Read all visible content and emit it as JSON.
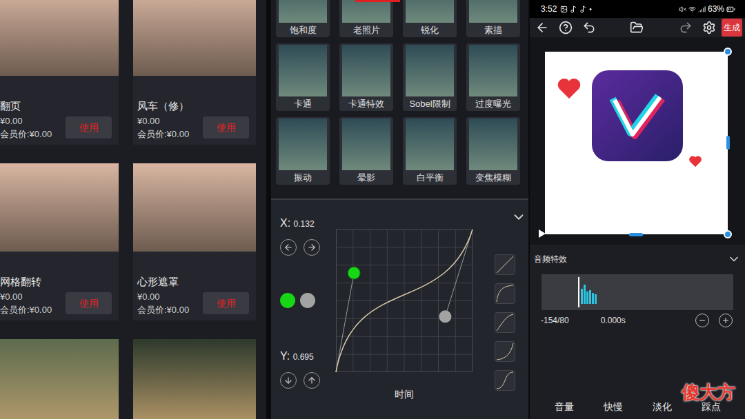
{
  "transitions": {
    "cards": [
      {
        "title": "翻页",
        "price": "¥0.00",
        "member_price": "会员价:¥0.00",
        "button": "使用"
      },
      {
        "title": "风车（修）",
        "price": "¥0.00",
        "member_price": "会员价:¥0.00",
        "button": "使用"
      },
      {
        "title": "网格翻转",
        "price": "¥0.00",
        "member_price": "会员价:¥0.00",
        "button": "使用"
      },
      {
        "title": "心形遮罩",
        "price": "¥0.00",
        "member_price": "会员价:¥0.00",
        "button": "使用"
      }
    ]
  },
  "filters": {
    "labels": [
      "饱和度",
      "老照片",
      "锐化",
      "素描",
      "卡通",
      "卡通特效",
      "Sobel限制",
      "过度曝光",
      "振动",
      "晕影",
      "白平衡",
      "变焦模糊"
    ]
  },
  "curve_editor": {
    "x_label": "X:",
    "x_value": "0.132",
    "y_label": "Y:",
    "y_value": "0.695",
    "axis_label": "时间",
    "points": [
      {
        "x": 0.132,
        "y": 0.695,
        "color": "#16d616",
        "selected": true
      },
      {
        "x": 0.8,
        "y": 0.39,
        "color": "#a3a3a3",
        "selected": false
      }
    ],
    "presets": [
      {
        "kind": "linear"
      },
      {
        "kind": "ease-out"
      },
      {
        "kind": "ease"
      },
      {
        "kind": "ease-in"
      },
      {
        "kind": "ease-in-out"
      }
    ]
  },
  "editor": {
    "status_bar": {
      "time": "3:52",
      "battery": "63%"
    },
    "toolbar": {
      "generate": "生成"
    },
    "audio_effects": {
      "title": "音频特效",
      "reading": "-154/80",
      "time": "0.000s",
      "playhead": 0.19,
      "bars": [
        0.55,
        0.7,
        0.45,
        0.5,
        0.4,
        0.35
      ]
    },
    "bottom_tabs": [
      "音量",
      "快慢",
      "淡化",
      "踩点"
    ]
  },
  "watermark": "傻大方"
}
